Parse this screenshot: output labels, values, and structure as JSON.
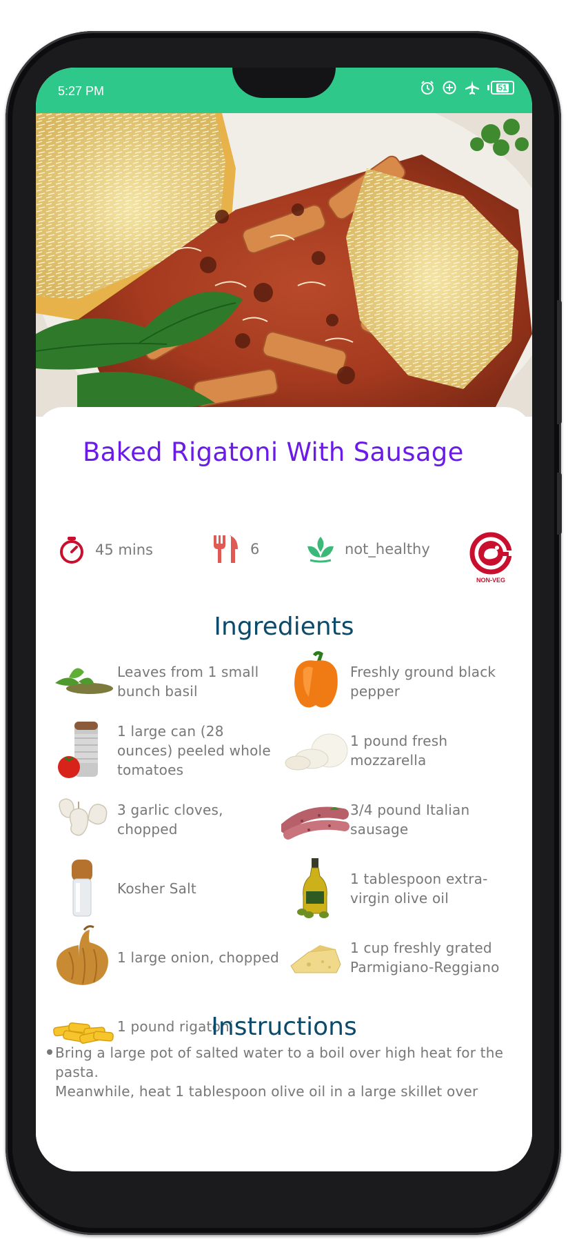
{
  "status_bar": {
    "time": "5:27 PM",
    "battery": "51",
    "icons": [
      "alarm-icon",
      "data-saver-icon",
      "airplane-icon",
      "battery-icon"
    ]
  },
  "colors": {
    "status_bar": "#2ec98a",
    "title": "#6a1be8",
    "section_title": "#0b4a6a",
    "body_text": "#777777",
    "timer_icon": "#c8102e",
    "cutlery_icon": "#e05a55",
    "leaf_icon": "#3bb978",
    "nonveg_badge": "#c8102e"
  },
  "recipe": {
    "title": "Baked Rigatoni With Sausage",
    "time": "45 mins",
    "servings": "6",
    "health": "not_healthy",
    "badge_text": "NON-VEG"
  },
  "ingredients": {
    "heading": "Ingredients",
    "items": [
      {
        "icon": "basil-icon",
        "text": "Leaves from 1 small bunch basil"
      },
      {
        "icon": "bell-pepper-icon",
        "text": "Freshly ground black pepper"
      },
      {
        "icon": "tomato-can-icon",
        "text": "1 large can (28 ounces) peeled whole tomatoes"
      },
      {
        "icon": "mozzarella-icon",
        "text": "1 pound fresh mozzarella"
      },
      {
        "icon": "garlic-icon",
        "text": "3 garlic cloves, chopped"
      },
      {
        "icon": "sausage-icon",
        "text": "3/4 pound Italian sausage"
      },
      {
        "icon": "salt-shaker-icon",
        "text": "Kosher Salt"
      },
      {
        "icon": "olive-oil-icon",
        "text": "1 tablespoon extra-virgin olive oil"
      },
      {
        "icon": "onion-icon",
        "text": "1 large onion, chopped"
      },
      {
        "icon": "parmesan-icon",
        "text": "1 cup freshly grated Parmigiano-Reggiano"
      },
      {
        "icon": "rigatoni-icon",
        "text": "1 pound rigatoni"
      }
    ]
  },
  "instructions": {
    "heading": "Instructions",
    "line1": "Bring a large pot of salted water to a boil over high heat for the pasta.",
    "line2": "Meanwhile, heat 1 tablespoon olive oil in a large skillet over"
  }
}
